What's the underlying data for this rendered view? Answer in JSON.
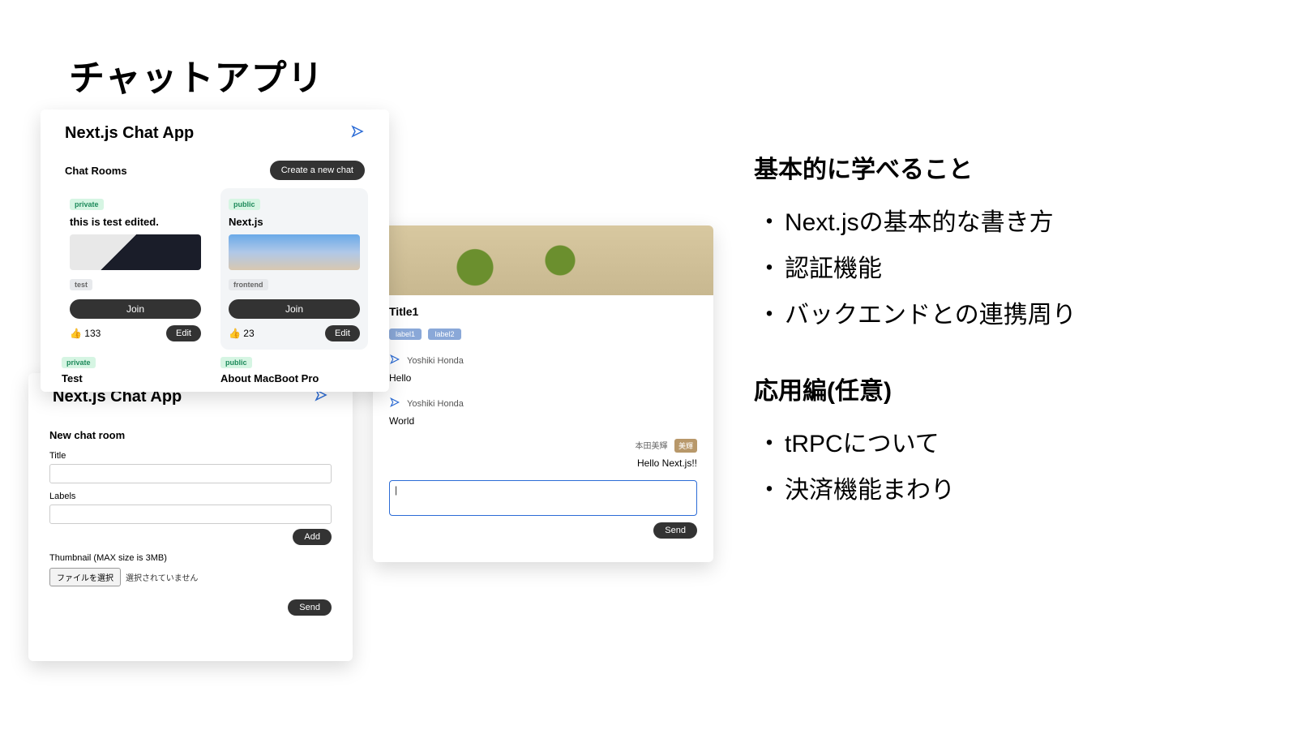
{
  "slide_title": "チャットアプリ",
  "right": {
    "basic_h": "基本的に学べること",
    "basic_items": [
      "Next.jsの基本的な書き方",
      "認証機能",
      "バックエンドとの連携周り"
    ],
    "adv_h": "応用編(任意)",
    "adv_items": [
      "tRPCについて",
      "決済機能まわり"
    ]
  },
  "panel1": {
    "app_title": "Next.js Chat App",
    "rooms_h": "Chat Rooms",
    "create_btn": "Create a new chat",
    "cards": [
      {
        "privacy": "private",
        "title": "this is test edited.",
        "tag": "test",
        "join": "Join",
        "likes": "👍 133",
        "edit": "Edit"
      },
      {
        "privacy": "public",
        "title": "Next.js",
        "tag": "frontend",
        "join": "Join",
        "likes": "👍 23",
        "edit": "Edit"
      }
    ],
    "more": [
      {
        "privacy": "private",
        "title": "Test"
      },
      {
        "privacy": "public",
        "title": "About MacBoot Pro"
      }
    ]
  },
  "panel2": {
    "app_title": "Next.js Chat App",
    "form_h": "New chat room",
    "title_label": "Title",
    "labels_label": "Labels",
    "add_btn": "Add",
    "thumb_label": "Thumbnail (MAX size is 3MB)",
    "file_btn": "ファイルを選択",
    "file_note": "選択されていません",
    "send_btn": "Send"
  },
  "panel3": {
    "title": "Title1",
    "labels": [
      "label1",
      "label2"
    ],
    "messages": [
      {
        "user": "Yoshiki Honda",
        "text": "Hello"
      },
      {
        "user": "Yoshiki Honda",
        "text": "World"
      }
    ],
    "right_msg": {
      "who": "本田美輝",
      "chip": "美輝",
      "text": "Hello Next.js!!"
    },
    "send_btn": "Send"
  }
}
